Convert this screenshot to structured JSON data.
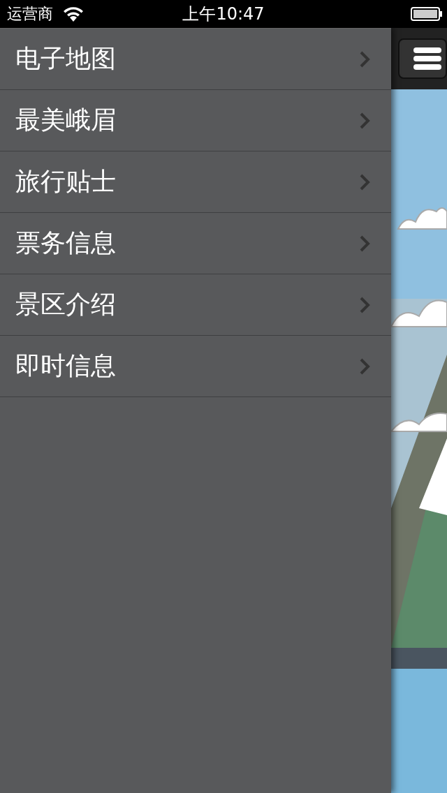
{
  "status_bar": {
    "carrier": "运营商",
    "time": "上午10:47"
  },
  "menu": {
    "items": [
      {
        "label": "电子地图"
      },
      {
        "label": "最美峨眉"
      },
      {
        "label": "旅行贴士"
      },
      {
        "label": "票务信息"
      },
      {
        "label": "景区介绍"
      },
      {
        "label": "即时信息"
      }
    ]
  }
}
